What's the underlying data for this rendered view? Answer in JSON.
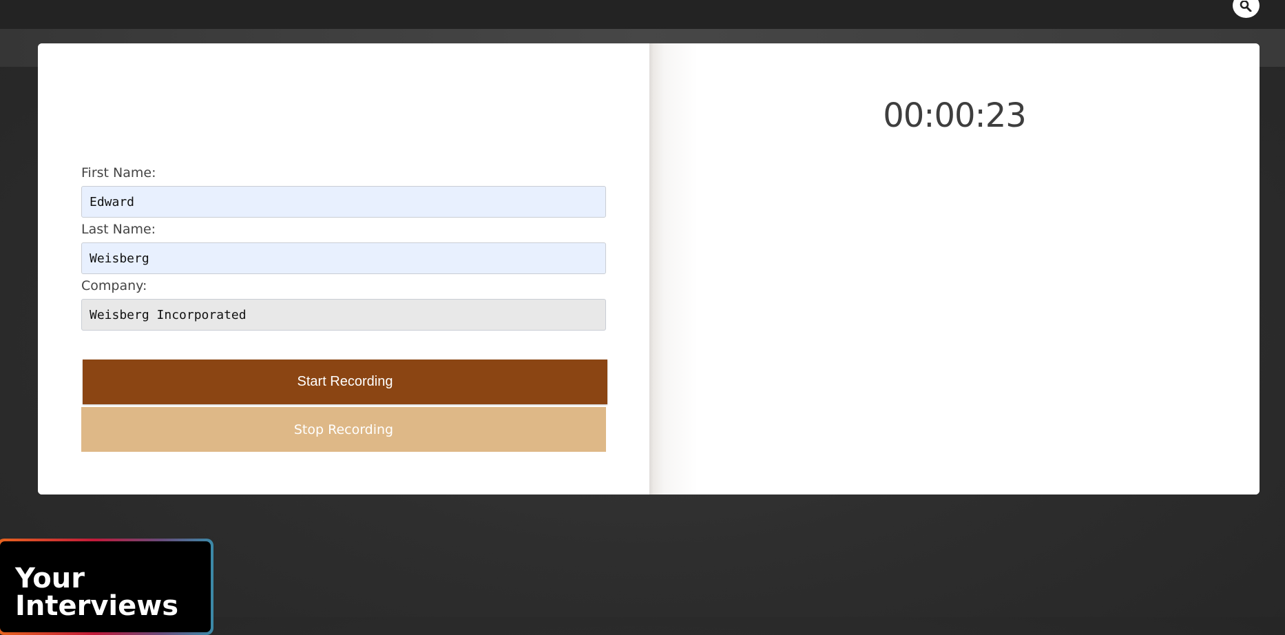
{
  "header": {
    "search_icon": "search-icon"
  },
  "form": {
    "first_name": {
      "label": "First Name:",
      "value": "Edward"
    },
    "last_name": {
      "label": "Last Name:",
      "value": "Weisberg"
    },
    "company": {
      "label": "Company:",
      "value": "Weisberg Incorporated"
    },
    "start_button": "Start Recording",
    "stop_button": "Stop Recording"
  },
  "recorder": {
    "timer": "00:00:23"
  },
  "promo": {
    "title": "Your Interviews"
  },
  "colors": {
    "start_button": "#8b4513",
    "stop_button": "#deb887",
    "autofill_field": "#e8f0fe",
    "readonly_field": "#e8e8e8"
  }
}
